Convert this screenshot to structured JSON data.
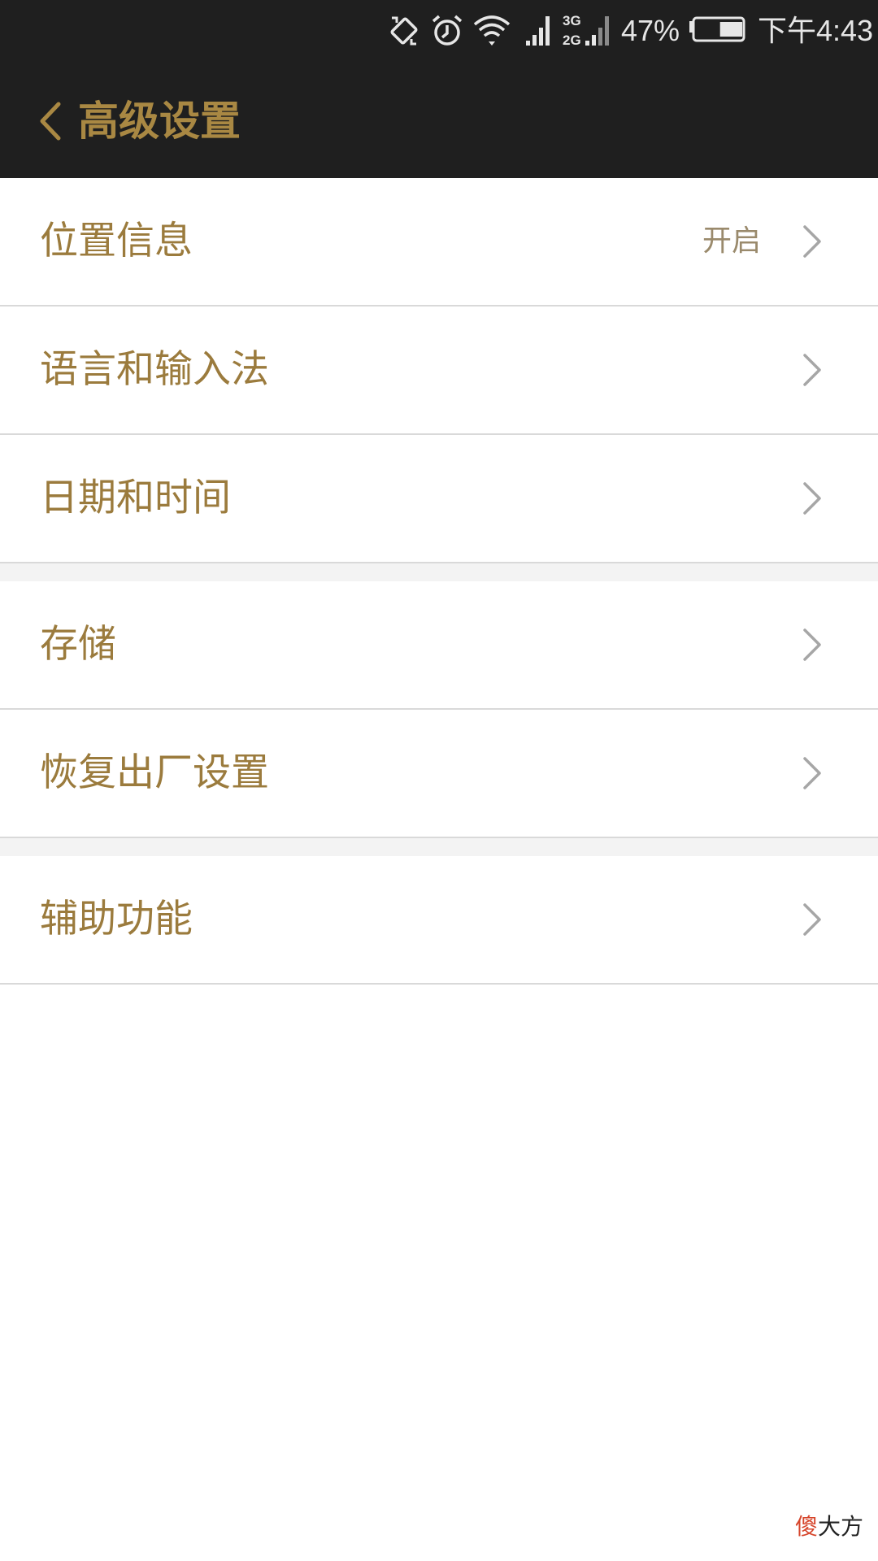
{
  "status_bar": {
    "battery_percent": "47%",
    "battery_level": 0.47,
    "time": "下午4:43",
    "network_top": "3G",
    "network_bottom": "2G",
    "icons": [
      "rotation-lock-icon",
      "alarm-icon",
      "wifi-icon",
      "signal-icon",
      "dual-signal-icon",
      "battery-icon"
    ]
  },
  "header": {
    "back_icon": "chevron-left-icon",
    "title": "高级设置"
  },
  "groups": [
    {
      "items": [
        {
          "label": "位置信息",
          "value": "开启"
        },
        {
          "label": "语言和输入法"
        },
        {
          "label": "日期和时间"
        }
      ]
    },
    {
      "items": [
        {
          "label": "存储"
        },
        {
          "label": "恢复出厂设置"
        }
      ]
    },
    {
      "items": [
        {
          "label": "辅助功能"
        }
      ]
    }
  ],
  "watermark": {
    "accent": "傻",
    "rest": "大方"
  },
  "colors": {
    "bar_bg": "#1f1f1f",
    "accent_gold": "#a98843",
    "label_gold": "#9b7b3d",
    "divider": "#d9d9d9",
    "chevron": "#a6a6a6"
  }
}
